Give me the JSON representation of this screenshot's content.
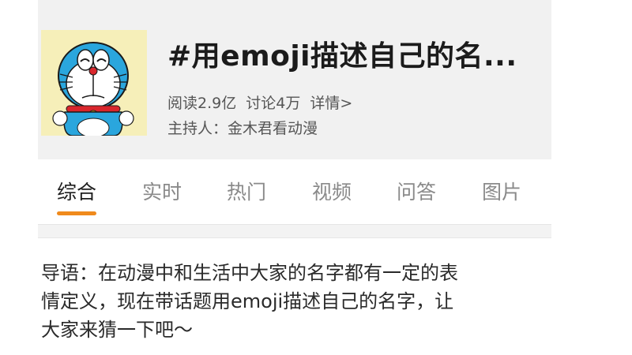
{
  "header": {
    "title": "#用emoji描述自己的名...",
    "stats": {
      "reads": "阅读2.9亿",
      "discussions": "讨论4万",
      "details_link": "详情>"
    },
    "host": "主持人：金木君看动漫",
    "avatar_icon": "doraemon-avatar-icon"
  },
  "tabs": [
    {
      "label": "综合",
      "active": true
    },
    {
      "label": "实时",
      "active": false
    },
    {
      "label": "热门",
      "active": false
    },
    {
      "label": "视频",
      "active": false
    },
    {
      "label": "问答",
      "active": false
    },
    {
      "label": "图片",
      "active": false
    }
  ],
  "intro": {
    "line1": "导语：在动漫中和生活中大家的名字都有一定的表",
    "line2": "情定义，现在带话题用emoji描述自己的名字，让",
    "line3": "大家来猜一下吧～"
  },
  "colors": {
    "accent": "#f08a1c",
    "header_bg": "#f1f1f1",
    "avatar_bg": "#f6efb9"
  }
}
